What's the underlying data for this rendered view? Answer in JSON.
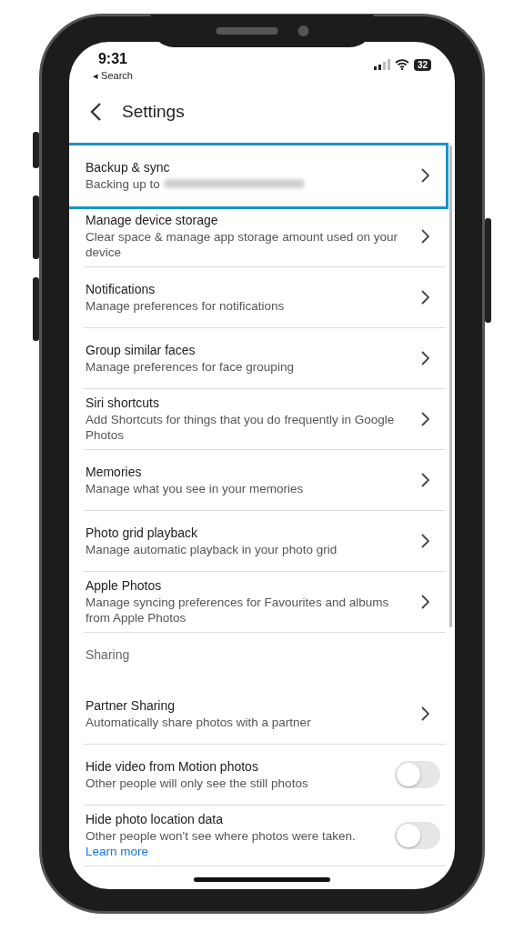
{
  "status_bar": {
    "time": "9:31",
    "back_app": "◂ Search",
    "battery": "32"
  },
  "header": {
    "title": "Settings"
  },
  "rows": [
    {
      "kind": "link",
      "title": "Backup & sync",
      "subtitle": "Backing up to",
      "redacted": true,
      "highlighted": true
    },
    {
      "kind": "link",
      "title": "Manage device storage",
      "subtitle": "Clear space & manage app storage amount used on your device",
      "redacted": false,
      "highlighted": false
    },
    {
      "kind": "link",
      "title": "Notifications",
      "subtitle": "Manage preferences for notifications",
      "redacted": false,
      "highlighted": false
    },
    {
      "kind": "link",
      "title": "Group similar faces",
      "subtitle": "Manage preferences for face grouping",
      "redacted": false,
      "highlighted": false
    },
    {
      "kind": "link",
      "title": "Siri shortcuts",
      "subtitle": "Add Shortcuts for things that you do frequently in Google Photos",
      "redacted": false,
      "highlighted": false
    },
    {
      "kind": "link",
      "title": "Memories",
      "subtitle": "Manage what you see in your memories",
      "redacted": false,
      "highlighted": false
    },
    {
      "kind": "link",
      "title": "Photo grid playback",
      "subtitle": "Manage automatic playback in your photo grid",
      "redacted": false,
      "highlighted": false
    },
    {
      "kind": "link",
      "title": "Apple Photos",
      "subtitle": "Manage syncing preferences for Favourites and albums from Apple Photos",
      "redacted": false,
      "highlighted": false
    },
    {
      "kind": "section",
      "title": "Sharing"
    },
    {
      "kind": "link",
      "title": "Partner Sharing",
      "subtitle": "Automatically share photos with a partner",
      "redacted": false,
      "highlighted": false
    },
    {
      "kind": "toggle",
      "title": "Hide video from Motion photos",
      "subtitle": "Other people will only see the still photos",
      "on": false
    },
    {
      "kind": "toggle",
      "title": "Hide photo location data",
      "subtitle": "Other people won't see where photos were taken.",
      "link": "Learn more",
      "on": false
    }
  ]
}
